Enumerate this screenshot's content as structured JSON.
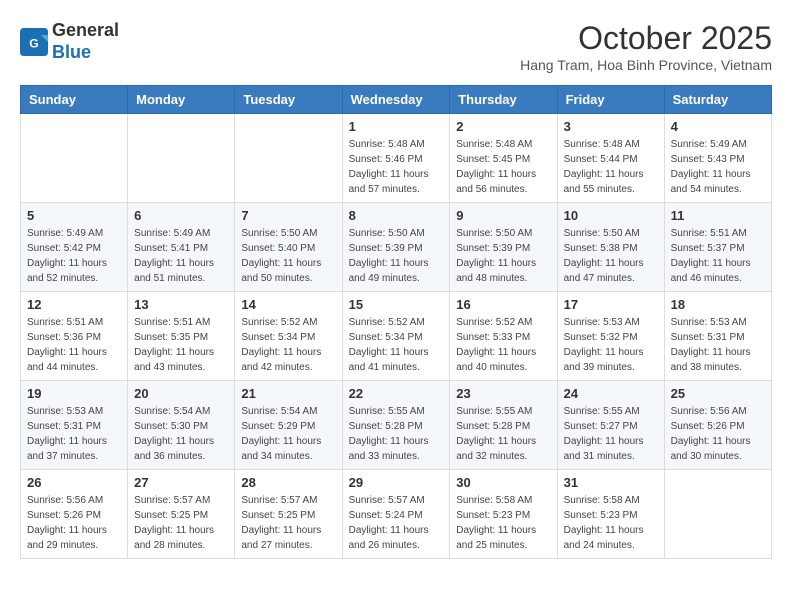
{
  "header": {
    "logo_general": "General",
    "logo_blue": "Blue",
    "month_title": "October 2025",
    "subtitle": "Hang Tram, Hoa Binh Province, Vietnam"
  },
  "days_of_week": [
    "Sunday",
    "Monday",
    "Tuesday",
    "Wednesday",
    "Thursday",
    "Friday",
    "Saturday"
  ],
  "weeks": [
    [
      {
        "day": "",
        "sunrise": "",
        "sunset": "",
        "daylight": ""
      },
      {
        "day": "",
        "sunrise": "",
        "sunset": "",
        "daylight": ""
      },
      {
        "day": "",
        "sunrise": "",
        "sunset": "",
        "daylight": ""
      },
      {
        "day": "1",
        "sunrise": "Sunrise: 5:48 AM",
        "sunset": "Sunset: 5:46 PM",
        "daylight": "Daylight: 11 hours and 57 minutes."
      },
      {
        "day": "2",
        "sunrise": "Sunrise: 5:48 AM",
        "sunset": "Sunset: 5:45 PM",
        "daylight": "Daylight: 11 hours and 56 minutes."
      },
      {
        "day": "3",
        "sunrise": "Sunrise: 5:48 AM",
        "sunset": "Sunset: 5:44 PM",
        "daylight": "Daylight: 11 hours and 55 minutes."
      },
      {
        "day": "4",
        "sunrise": "Sunrise: 5:49 AM",
        "sunset": "Sunset: 5:43 PM",
        "daylight": "Daylight: 11 hours and 54 minutes."
      }
    ],
    [
      {
        "day": "5",
        "sunrise": "Sunrise: 5:49 AM",
        "sunset": "Sunset: 5:42 PM",
        "daylight": "Daylight: 11 hours and 52 minutes."
      },
      {
        "day": "6",
        "sunrise": "Sunrise: 5:49 AM",
        "sunset": "Sunset: 5:41 PM",
        "daylight": "Daylight: 11 hours and 51 minutes."
      },
      {
        "day": "7",
        "sunrise": "Sunrise: 5:50 AM",
        "sunset": "Sunset: 5:40 PM",
        "daylight": "Daylight: 11 hours and 50 minutes."
      },
      {
        "day": "8",
        "sunrise": "Sunrise: 5:50 AM",
        "sunset": "Sunset: 5:39 PM",
        "daylight": "Daylight: 11 hours and 49 minutes."
      },
      {
        "day": "9",
        "sunrise": "Sunrise: 5:50 AM",
        "sunset": "Sunset: 5:39 PM",
        "daylight": "Daylight: 11 hours and 48 minutes."
      },
      {
        "day": "10",
        "sunrise": "Sunrise: 5:50 AM",
        "sunset": "Sunset: 5:38 PM",
        "daylight": "Daylight: 11 hours and 47 minutes."
      },
      {
        "day": "11",
        "sunrise": "Sunrise: 5:51 AM",
        "sunset": "Sunset: 5:37 PM",
        "daylight": "Daylight: 11 hours and 46 minutes."
      }
    ],
    [
      {
        "day": "12",
        "sunrise": "Sunrise: 5:51 AM",
        "sunset": "Sunset: 5:36 PM",
        "daylight": "Daylight: 11 hours and 44 minutes."
      },
      {
        "day": "13",
        "sunrise": "Sunrise: 5:51 AM",
        "sunset": "Sunset: 5:35 PM",
        "daylight": "Daylight: 11 hours and 43 minutes."
      },
      {
        "day": "14",
        "sunrise": "Sunrise: 5:52 AM",
        "sunset": "Sunset: 5:34 PM",
        "daylight": "Daylight: 11 hours and 42 minutes."
      },
      {
        "day": "15",
        "sunrise": "Sunrise: 5:52 AM",
        "sunset": "Sunset: 5:34 PM",
        "daylight": "Daylight: 11 hours and 41 minutes."
      },
      {
        "day": "16",
        "sunrise": "Sunrise: 5:52 AM",
        "sunset": "Sunset: 5:33 PM",
        "daylight": "Daylight: 11 hours and 40 minutes."
      },
      {
        "day": "17",
        "sunrise": "Sunrise: 5:53 AM",
        "sunset": "Sunset: 5:32 PM",
        "daylight": "Daylight: 11 hours and 39 minutes."
      },
      {
        "day": "18",
        "sunrise": "Sunrise: 5:53 AM",
        "sunset": "Sunset: 5:31 PM",
        "daylight": "Daylight: 11 hours and 38 minutes."
      }
    ],
    [
      {
        "day": "19",
        "sunrise": "Sunrise: 5:53 AM",
        "sunset": "Sunset: 5:31 PM",
        "daylight": "Daylight: 11 hours and 37 minutes."
      },
      {
        "day": "20",
        "sunrise": "Sunrise: 5:54 AM",
        "sunset": "Sunset: 5:30 PM",
        "daylight": "Daylight: 11 hours and 36 minutes."
      },
      {
        "day": "21",
        "sunrise": "Sunrise: 5:54 AM",
        "sunset": "Sunset: 5:29 PM",
        "daylight": "Daylight: 11 hours and 34 minutes."
      },
      {
        "day": "22",
        "sunrise": "Sunrise: 5:55 AM",
        "sunset": "Sunset: 5:28 PM",
        "daylight": "Daylight: 11 hours and 33 minutes."
      },
      {
        "day": "23",
        "sunrise": "Sunrise: 5:55 AM",
        "sunset": "Sunset: 5:28 PM",
        "daylight": "Daylight: 11 hours and 32 minutes."
      },
      {
        "day": "24",
        "sunrise": "Sunrise: 5:55 AM",
        "sunset": "Sunset: 5:27 PM",
        "daylight": "Daylight: 11 hours and 31 minutes."
      },
      {
        "day": "25",
        "sunrise": "Sunrise: 5:56 AM",
        "sunset": "Sunset: 5:26 PM",
        "daylight": "Daylight: 11 hours and 30 minutes."
      }
    ],
    [
      {
        "day": "26",
        "sunrise": "Sunrise: 5:56 AM",
        "sunset": "Sunset: 5:26 PM",
        "daylight": "Daylight: 11 hours and 29 minutes."
      },
      {
        "day": "27",
        "sunrise": "Sunrise: 5:57 AM",
        "sunset": "Sunset: 5:25 PM",
        "daylight": "Daylight: 11 hours and 28 minutes."
      },
      {
        "day": "28",
        "sunrise": "Sunrise: 5:57 AM",
        "sunset": "Sunset: 5:25 PM",
        "daylight": "Daylight: 11 hours and 27 minutes."
      },
      {
        "day": "29",
        "sunrise": "Sunrise: 5:57 AM",
        "sunset": "Sunset: 5:24 PM",
        "daylight": "Daylight: 11 hours and 26 minutes."
      },
      {
        "day": "30",
        "sunrise": "Sunrise: 5:58 AM",
        "sunset": "Sunset: 5:23 PM",
        "daylight": "Daylight: 11 hours and 25 minutes."
      },
      {
        "day": "31",
        "sunrise": "Sunrise: 5:58 AM",
        "sunset": "Sunset: 5:23 PM",
        "daylight": "Daylight: 11 hours and 24 minutes."
      },
      {
        "day": "",
        "sunrise": "",
        "sunset": "",
        "daylight": ""
      }
    ]
  ]
}
